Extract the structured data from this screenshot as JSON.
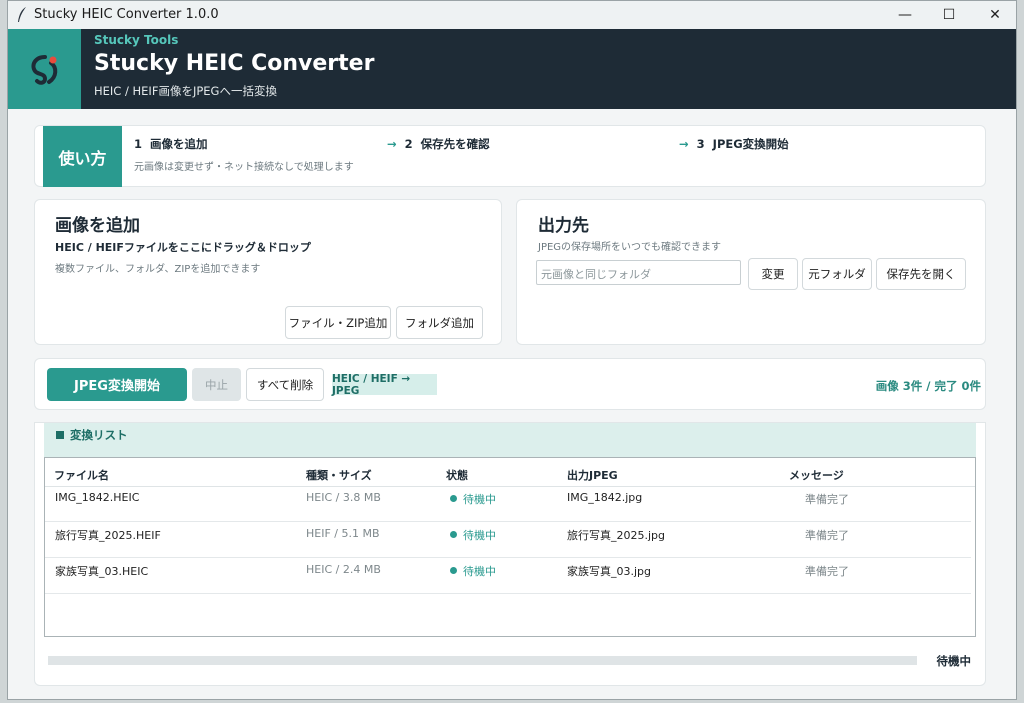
{
  "titlebar": {
    "title": "Stucky HEIC Converter 1.0.0",
    "minimize": "—",
    "maximize": "☐",
    "close": "✕"
  },
  "header": {
    "brand": "Stucky Tools",
    "title": "Stucky HEIC Converter",
    "subtitle": "HEIC / HEIF画像をJPEGへ一括変換"
  },
  "howto": {
    "badge": "使い方",
    "steps": [
      {
        "num": "1",
        "label": "画像を追加"
      },
      {
        "num": "2",
        "label": "保存先を確認"
      },
      {
        "num": "3",
        "label": "JPEG変換開始"
      }
    ],
    "arrow": "→",
    "note": "元画像は変更せず・ネット接続なしで処理します"
  },
  "add": {
    "title": "画像を追加",
    "drop_text": "HEIC / HEIFファイルをここにドラッグ＆ドロップ",
    "note": "複数ファイル、フォルダ、ZIPを追加できます",
    "add_files": "ファイル・ZIP追加",
    "add_folder": "フォルダ追加"
  },
  "output": {
    "title": "出力先",
    "note": "JPEGの保存場所をいつでも確認できます",
    "path_placeholder": "元画像と同じフォルダ",
    "change": "変更",
    "source_folder": "元フォルダ",
    "open_dest": "保存先を開く"
  },
  "actions": {
    "start": "JPEG変換開始",
    "stop": "中止",
    "clear": "すべて削除",
    "format": "HEIC / HEIF → JPEG",
    "count": "画像 3件 / 完了 0件"
  },
  "list": {
    "title": "変換リスト",
    "columns": [
      "ファイル名",
      "種類・サイズ",
      "状態",
      "出力JPEG",
      "メッセージ"
    ],
    "rows": [
      {
        "name": "IMG_1842.HEIC",
        "type_size": "HEIC / 3.8 MB",
        "status": "待機中",
        "output": "IMG_1842.jpg",
        "message": "準備完了"
      },
      {
        "name": "旅行写真_2025.HEIF",
        "type_size": "HEIF / 5.1 MB",
        "status": "待機中",
        "output": "旅行写真_2025.jpg",
        "message": "準備完了"
      },
      {
        "name": "家族写真_03.HEIC",
        "type_size": "HEIC / 2.4 MB",
        "status": "待機中",
        "output": "家族写真_03.jpg",
        "message": "準備完了"
      }
    ]
  },
  "progress": {
    "value": 0,
    "label": "待機中"
  },
  "colors": {
    "accent": "#2a9a8f",
    "header_bg": "#1e2b36",
    "status_accent": "#2a9a8f"
  }
}
